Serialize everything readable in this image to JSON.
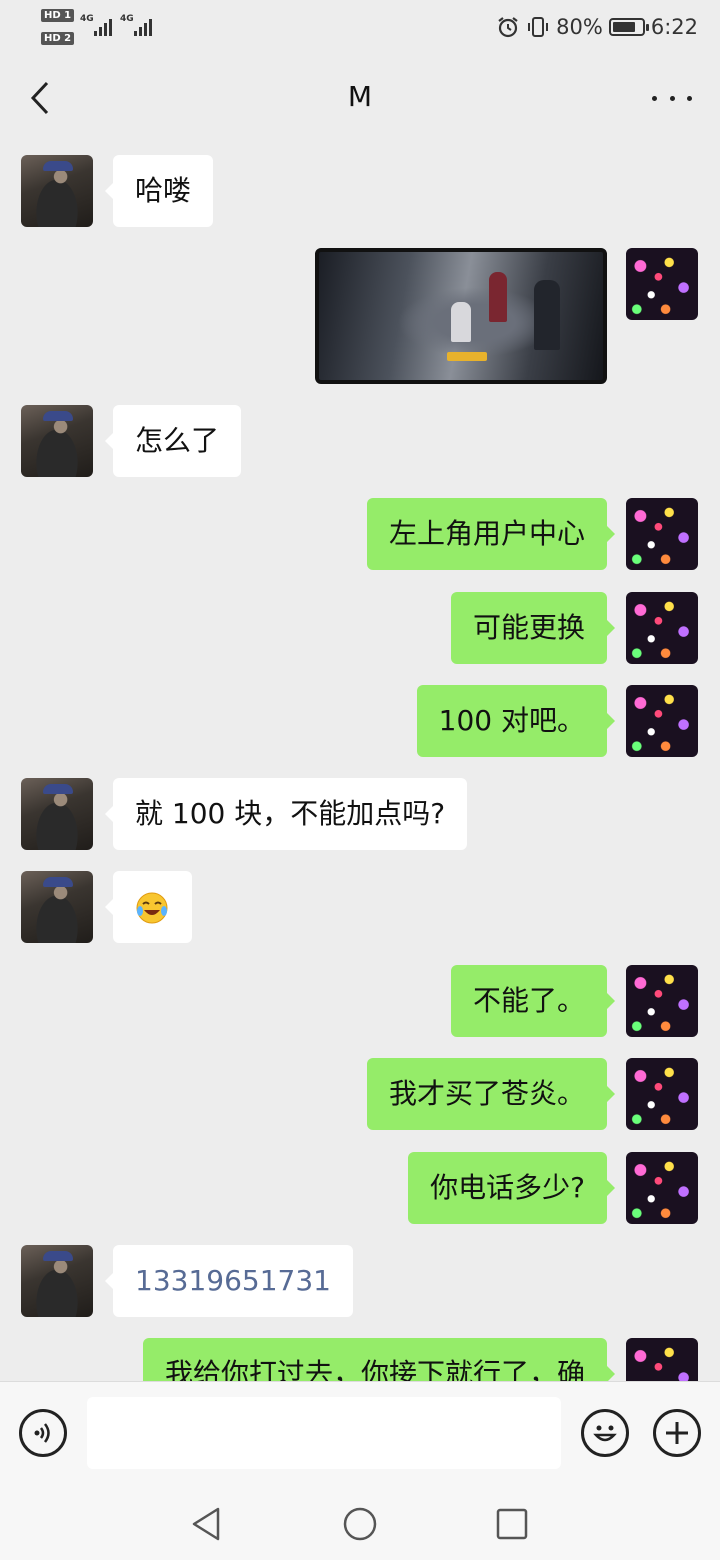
{
  "status_bar": {
    "sim1": "HD 1",
    "sim2": "HD 2",
    "net1": "4G",
    "net2": "4G",
    "battery": "80%",
    "battery_level": 0.8,
    "time": "6:22"
  },
  "nav": {
    "title": "M"
  },
  "messages": [
    {
      "side": "left",
      "type": "text",
      "text": "哈喽"
    },
    {
      "side": "right",
      "type": "image"
    },
    {
      "side": "left",
      "type": "text",
      "text": "怎么了"
    },
    {
      "side": "right",
      "type": "text",
      "text": "左上角用户中心"
    },
    {
      "side": "right",
      "type": "text",
      "text": "可能更换"
    },
    {
      "side": "right",
      "type": "text",
      "text": "100 对吧。"
    },
    {
      "side": "left",
      "type": "text",
      "text": "就 100 块，不能加点吗?"
    },
    {
      "side": "left",
      "type": "emoji",
      "icon": "laugh-cry-emoji"
    },
    {
      "side": "right",
      "type": "text",
      "text": "不能了。"
    },
    {
      "side": "right",
      "type": "text",
      "text": "我才买了苍炎。"
    },
    {
      "side": "right",
      "type": "text",
      "text": "你电话多少?"
    },
    {
      "side": "left",
      "type": "phone",
      "text": "13319651731"
    },
    {
      "side": "right",
      "type": "text",
      "text": "我给你打过去，你接下就行了，确"
    }
  ],
  "input_bar": {
    "placeholder": "",
    "icons": [
      "voice-icon",
      "emoji-icon",
      "plus-icon"
    ]
  },
  "system_nav": {
    "icons": [
      "back-triangle-icon",
      "home-circle-icon",
      "recents-square-icon"
    ]
  },
  "colors": {
    "background": "#ededed",
    "bubble_self": "#95ec69",
    "bubble_other": "#ffffff",
    "link": "#576b95"
  }
}
